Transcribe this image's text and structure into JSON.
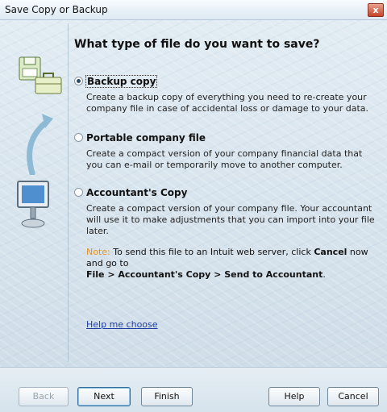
{
  "window": {
    "title": "Save Copy or Backup",
    "close_glyph": "x"
  },
  "heading": "What type of file do you want to save?",
  "options": [
    {
      "label": "Backup copy",
      "selected": true,
      "desc": "Create a backup copy of everything you need to re-create your company file in case of accidental loss or damage to your data."
    },
    {
      "label": "Portable company file",
      "selected": false,
      "desc": "Create a compact version of your company financial data that you can e-mail or temporarily move to another computer."
    },
    {
      "label": "Accountant's Copy",
      "selected": false,
      "desc": "Create a compact version of your company file. Your accountant will use it to make adjustments that you can import into your file later."
    }
  ],
  "note": {
    "label": "Note:",
    "text1": " To send this file to an Intuit web server, click ",
    "cancel_word": "Cancel",
    "text2": " now and go to ",
    "path": "File > Accountant's Copy > Send to Accountant",
    "end": "."
  },
  "help_link": "Help me choose",
  "buttons": {
    "back": "Back",
    "next": "Next",
    "finish": "Finish",
    "help": "Help",
    "cancel": "Cancel"
  },
  "icons": [
    "disk-icon",
    "briefcase-icon",
    "arrow-icon",
    "monitor-icon"
  ],
  "colors": {
    "note_label": "#e8901a",
    "link": "#1f3da0",
    "close_button": "#c7442a"
  }
}
